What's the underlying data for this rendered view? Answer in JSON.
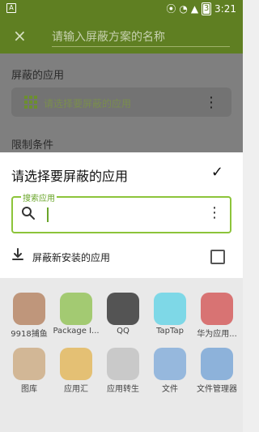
{
  "status": {
    "time": "3:21",
    "battery": "3",
    "left_glyph": "A"
  },
  "toolbar": {
    "close_icon": "×",
    "title_placeholder": "请输入屏蔽方案的名称"
  },
  "background": {
    "section1_label": "屏蔽的应用",
    "card_text": "请选择要屏蔽的应用",
    "section2_label": "限制条件"
  },
  "sheet": {
    "title": "请选择要屏蔽的应用",
    "confirm_icon": "✓",
    "search": {
      "label": "搜索应用",
      "value": "",
      "icon": "search-icon"
    },
    "install_row_label": "屏蔽新安装的应用",
    "install_checked": false
  },
  "apps": [
    {
      "label": "9918捕鱼",
      "color": "#b07a56"
    },
    {
      "label": "Package I...",
      "color": "#8bbf4a"
    },
    {
      "label": "QQ",
      "color": "#222222"
    },
    {
      "label": "TapTap",
      "color": "#5ad1e6"
    },
    {
      "label": "华为应用...",
      "color": "#d24b4b"
    },
    {
      "label": "图库",
      "color": "#c9a57a"
    },
    {
      "label": "应用汇",
      "color": "#e2b14c"
    },
    {
      "label": "应用转生",
      "color": "#bdbdbd"
    },
    {
      "label": "文件",
      "color": "#7aa7d8"
    },
    {
      "label": "文件管理器",
      "color": "#6d9fd4"
    }
  ]
}
